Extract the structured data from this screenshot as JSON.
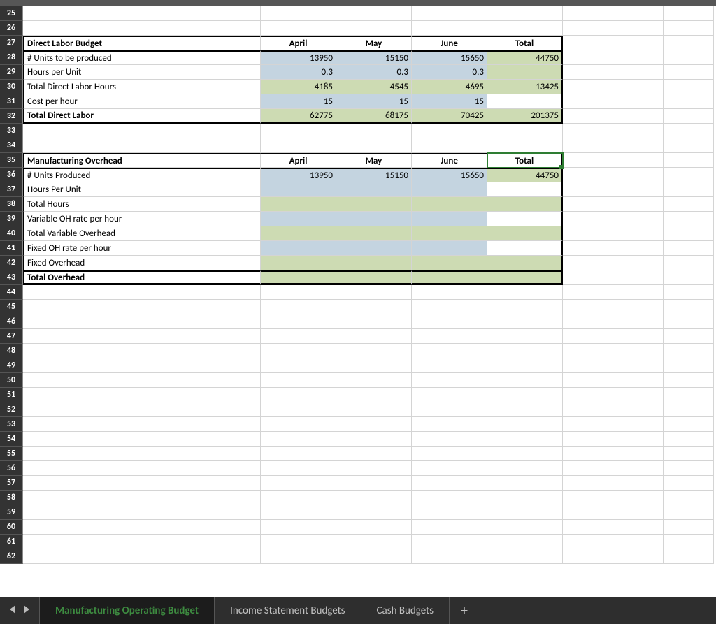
{
  "rows": [
    25,
    26,
    27,
    28,
    29,
    30,
    31,
    32,
    33,
    34,
    35,
    36,
    37,
    38,
    39,
    40,
    41,
    42,
    43,
    44,
    45,
    46,
    47,
    48,
    49,
    50,
    51,
    52,
    53,
    54,
    55,
    56,
    57,
    58,
    59,
    60,
    61,
    62
  ],
  "months": {
    "apr": "April",
    "may": "May",
    "jun": "June",
    "total": "Total"
  },
  "dlb": {
    "title": "Direct Labor Budget",
    "units_lbl": "# Units to be produced",
    "units": {
      "apr": "13950",
      "may": "15150",
      "jun": "15650",
      "total": "44750"
    },
    "hpu_lbl": "Hours per Unit",
    "hpu": {
      "apr": "0.3",
      "may": "0.3",
      "jun": "0.3"
    },
    "tdlh_lbl": "Total Direct Labor Hours",
    "tdlh": {
      "apr": "4185",
      "may": "4545",
      "jun": "4695",
      "total": "13425"
    },
    "cph_lbl": "Cost per hour",
    "cph": {
      "apr": "15",
      "may": "15",
      "jun": "15"
    },
    "tdl_lbl": "Total Direct Labor",
    "tdl": {
      "apr": "62775",
      "may": "68175",
      "jun": "70425",
      "total": "201375"
    }
  },
  "moh": {
    "title": "Manufacturing Overhead",
    "units_lbl": "# Units Produced",
    "units": {
      "apr": "13950",
      "may": "15150",
      "jun": "15650",
      "total": "44750"
    },
    "hpu_lbl": "Hours Per Unit",
    "th_lbl": "Total Hours",
    "voh_lbl": "Variable OH rate per hour",
    "tvoh_lbl": "Total Variable Overhead",
    "foh_lbl": "Fixed OH rate per hour",
    "fo_lbl": "Fixed Overhead",
    "to_lbl": "Total Overhead"
  },
  "tabs": {
    "t1": "Manufacturing Operating Budget",
    "t2": "Income Statement Budgets",
    "t3": "Cash Budgets"
  }
}
